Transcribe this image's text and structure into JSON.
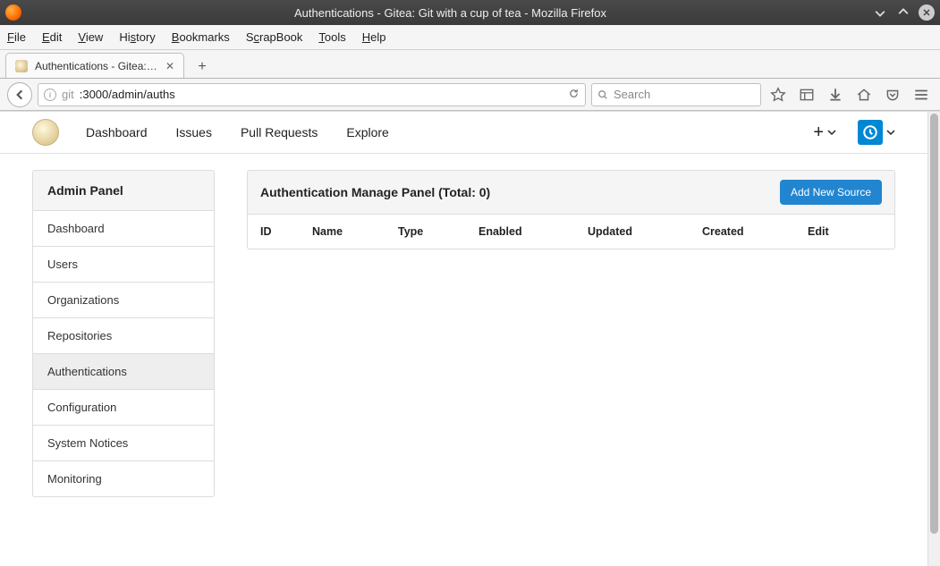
{
  "window": {
    "title": "Authentications - Gitea: Git with a cup of tea - Mozilla Firefox"
  },
  "menubar": [
    "File",
    "Edit",
    "View",
    "History",
    "Bookmarks",
    "ScrapBook",
    "Tools",
    "Help"
  ],
  "tab": {
    "title": "Authentications - Gitea: ..."
  },
  "urlbar": {
    "host_prefix": "git",
    "path": ":3000/admin/auths"
  },
  "searchbar": {
    "placeholder": "Search"
  },
  "gitea_nav": [
    "Dashboard",
    "Issues",
    "Pull Requests",
    "Explore"
  ],
  "sidebar": {
    "title": "Admin Panel",
    "items": [
      "Dashboard",
      "Users",
      "Organizations",
      "Repositories",
      "Authentications",
      "Configuration",
      "System Notices",
      "Monitoring"
    ],
    "active_index": 4
  },
  "main": {
    "title": "Authentication Manage Panel (Total: 0)",
    "add_button": "Add New Source",
    "columns": [
      "ID",
      "Name",
      "Type",
      "Enabled",
      "Updated",
      "Created",
      "Edit"
    ]
  }
}
